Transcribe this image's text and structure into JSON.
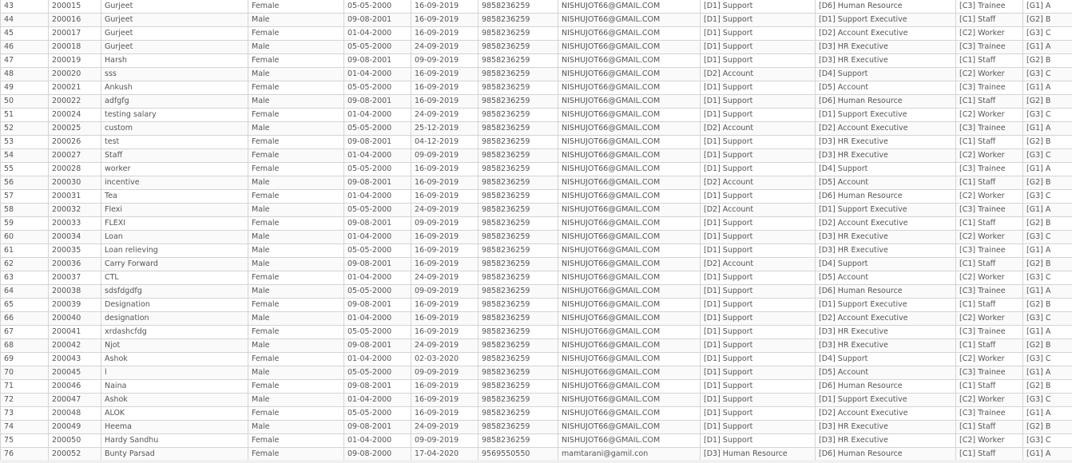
{
  "rows": [
    [
      "43",
      "200015",
      "Gurjeet",
      "Female",
      "05-05-2000",
      "16-09-2019",
      "9858236259",
      "NISHUJOT66@GMAIL.COM",
      "[D1] Support",
      "[D6] Human Resource",
      "[C3] Trainee",
      "[G1] A"
    ],
    [
      "44",
      "200016",
      "Gurjeet",
      "Male",
      "09-08-2001",
      "16-09-2019",
      "9858236259",
      "NISHUJOT66@GMAIL.COM",
      "[D1] Support",
      "[D1] Support Executive",
      "[C1] Staff",
      "[G2] B"
    ],
    [
      "45",
      "200017",
      "Gurjeet",
      "Female",
      "01-04-2000",
      "16-09-2019",
      "9858236259",
      "NISHUJOT66@GMAIL.COM",
      "[D1] Support",
      "[D2] Account Executive",
      "[C2] Worker",
      "[G3] C"
    ],
    [
      "46",
      "200018",
      "Gurjeet",
      "Male",
      "05-05-2000",
      "24-09-2019",
      "9858236259",
      "NISHUJOT66@GMAIL.COM",
      "[D1] Support",
      "[D3] HR Executive",
      "[C3] Trainee",
      "[G1] A"
    ],
    [
      "47",
      "200019",
      "Harsh",
      "Female",
      "09-08-2001",
      "09-09-2019",
      "9858236259",
      "NISHUJOT66@GMAIL.COM",
      "[D1] Support",
      "[D3] HR Executive",
      "[C1] Staff",
      "[G2] B"
    ],
    [
      "48",
      "200020",
      "sss",
      "Male",
      "01-04-2000",
      "16-09-2019",
      "9858236259",
      "NISHUJOT66@GMAIL.COM",
      "[D2] Account",
      "[D4] Support",
      "[C2] Worker",
      "[G3] C"
    ],
    [
      "49",
      "200021",
      "Ankush",
      "Female",
      "05-05-2000",
      "16-09-2019",
      "9858236259",
      "NISHUJOT66@GMAIL.COM",
      "[D1] Support",
      "[D5] Account",
      "[C3] Trainee",
      "[G1] A"
    ],
    [
      "50",
      "200022",
      "adfgfg",
      "Male",
      "09-08-2001",
      "16-09-2019",
      "9858236259",
      "NISHUJOT66@GMAIL.COM",
      "[D1] Support",
      "[D6] Human Resource",
      "[C1] Staff",
      "[G2] B"
    ],
    [
      "51",
      "200024",
      "testing salary",
      "Female",
      "01-04-2000",
      "24-09-2019",
      "9858236259",
      "NISHUJOT66@GMAIL.COM",
      "[D1] Support",
      "[D1] Support Executive",
      "[C2] Worker",
      "[G3] C"
    ],
    [
      "52",
      "200025",
      "custom",
      "Male",
      "05-05-2000",
      "25-12-2019",
      "9858236259",
      "NISHUJOT66@GMAIL.COM",
      "[D2] Account",
      "[D2] Account Executive",
      "[C3] Trainee",
      "[G1] A"
    ],
    [
      "53",
      "200026",
      "test",
      "Female",
      "09-08-2001",
      "04-12-2019",
      "9858236259",
      "NISHUJOT66@GMAIL.COM",
      "[D1] Support",
      "[D3] HR Executive",
      "[C1] Staff",
      "[G2] B"
    ],
    [
      "54",
      "200027",
      "Staff",
      "Female",
      "01-04-2000",
      "09-09-2019",
      "9858236259",
      "NISHUJOT66@GMAIL.COM",
      "[D1] Support",
      "[D3] HR Executive",
      "[C2] Worker",
      "[G3] C"
    ],
    [
      "55",
      "200028",
      "worker",
      "Female",
      "05-05-2000",
      "16-09-2019",
      "9858236259",
      "NISHUJOT66@GMAIL.COM",
      "[D1] Support",
      "[D4] Support",
      "[C3] Trainee",
      "[G1] A"
    ],
    [
      "56",
      "200030",
      "incentive",
      "Male",
      "09-08-2001",
      "16-09-2019",
      "9858236259",
      "NISHUJOT66@GMAIL.COM",
      "[D2] Account",
      "[D5] Account",
      "[C1] Staff",
      "[G2] B"
    ],
    [
      "57",
      "200031",
      "Tea",
      "Female",
      "01-04-2000",
      "16-09-2019",
      "9858236259",
      "NISHUJOT66@GMAIL.COM",
      "[D1] Support",
      "[D6] Human Resource",
      "[C2] Worker",
      "[G3] C"
    ],
    [
      "58",
      "200032",
      "Flexi",
      "Male",
      "05-05-2000",
      "24-09-2019",
      "9858236259",
      "NISHUJOT66@GMAIL.COM",
      "[D2] Account",
      "[D1] Support Executive",
      "[C3] Trainee",
      "[G1] A"
    ],
    [
      "59",
      "200033",
      "FLEXI",
      "Female",
      "09-08-2001",
      "09-09-2019",
      "9858236259",
      "NISHUJOT66@GMAIL.COM",
      "[D1] Support",
      "[D2] Account Executive",
      "[C1] Staff",
      "[G2] B"
    ],
    [
      "60",
      "200034",
      "Loan",
      "Male",
      "01-04-2000",
      "16-09-2019",
      "9858236259",
      "NISHUJOT66@GMAIL.COM",
      "[D1] Support",
      "[D3] HR Executive",
      "[C2] Worker",
      "[G3] C"
    ],
    [
      "61",
      "200035",
      "Loan relieving",
      "Male",
      "05-05-2000",
      "16-09-2019",
      "9858236259",
      "NISHUJOT66@GMAIL.COM",
      "[D1] Support",
      "[D3] HR Executive",
      "[C3] Trainee",
      "[G1] A"
    ],
    [
      "62",
      "200036",
      "Carry Forward",
      "Male",
      "09-08-2001",
      "16-09-2019",
      "9858236259",
      "NISHUJOT66@GMAIL.COM",
      "[D2] Account",
      "[D4] Support",
      "[C1] Staff",
      "[G2] B"
    ],
    [
      "63",
      "200037",
      "CTL",
      "Female",
      "01-04-2000",
      "24-09-2019",
      "9858236259",
      "NISHUJOT66@GMAIL.COM",
      "[D1] Support",
      "[D5] Account",
      "[C2] Worker",
      "[G3] C"
    ],
    [
      "64",
      "200038",
      "sdsfdgdfg",
      "Male",
      "05-05-2000",
      "09-09-2019",
      "9858236259",
      "NISHUJOT66@GMAIL.COM",
      "[D1] Support",
      "[D6] Human Resource",
      "[C3] Trainee",
      "[G1] A"
    ],
    [
      "65",
      "200039",
      "Designation",
      "Female",
      "09-08-2001",
      "16-09-2019",
      "9858236259",
      "NISHUJOT66@GMAIL.COM",
      "[D1] Support",
      "[D1] Support Executive",
      "[C1] Staff",
      "[G2] B"
    ],
    [
      "66",
      "200040",
      "designation",
      "Male",
      "01-04-2000",
      "16-09-2019",
      "9858236259",
      "NISHUJOT66@GMAIL.COM",
      "[D1] Support",
      "[D2] Account Executive",
      "[C2] Worker",
      "[G3] C"
    ],
    [
      "67",
      "200041",
      "xrdashcfdg",
      "Female",
      "05-05-2000",
      "16-09-2019",
      "9858236259",
      "NISHUJOT66@GMAIL.COM",
      "[D1] Support",
      "[D3] HR Executive",
      "[C3] Trainee",
      "[G1] A"
    ],
    [
      "68",
      "200042",
      "Njot",
      "Male",
      "09-08-2001",
      "24-09-2019",
      "9858236259",
      "NISHUJOT66@GMAIL.COM",
      "[D1] Support",
      "[D3] HR Executive",
      "[C1] Staff",
      "[G2] B"
    ],
    [
      "69",
      "200043",
      "Ashok",
      "Female",
      "01-04-2000",
      "02-03-2020",
      "9858236259",
      "NISHUJOT66@GMAIL.COM",
      "[D1] Support",
      "[D4] Support",
      "[C2] Worker",
      "[G3] C"
    ],
    [
      "70",
      "200045",
      "l",
      "Male",
      "05-05-2000",
      "09-09-2019",
      "9858236259",
      "NISHUJOT66@GMAIL.COM",
      "[D1] Support",
      "[D5] Account",
      "[C3] Trainee",
      "[G1] A"
    ],
    [
      "71",
      "200046",
      "Naina",
      "Female",
      "09-08-2001",
      "16-09-2019",
      "9858236259",
      "NISHUJOT66@GMAIL.COM",
      "[D1] Support",
      "[D6] Human Resource",
      "[C1] Staff",
      "[G2] B"
    ],
    [
      "72",
      "200047",
      "Ashok",
      "Male",
      "01-04-2000",
      "16-09-2019",
      "9858236259",
      "NISHUJOT66@GMAIL.COM",
      "[D1] Support",
      "[D1] Support Executive",
      "[C2] Worker",
      "[G3] C"
    ],
    [
      "73",
      "200048",
      "ALOK",
      "Female",
      "05-05-2000",
      "16-09-2019",
      "9858236259",
      "NISHUJOT66@GMAIL.COM",
      "[D1] Support",
      "[D2] Account Executive",
      "[C3] Trainee",
      "[G1] A"
    ],
    [
      "74",
      "200049",
      "Heema",
      "Male",
      "09-08-2001",
      "24-09-2019",
      "9858236259",
      "NISHUJOT66@GMAIL.COM",
      "[D1] Support",
      "[D3] HR Executive",
      "[C1] Staff",
      "[G2] B"
    ],
    [
      "75",
      "200050",
      "Hardy Sandhu",
      "Female",
      "01-04-2000",
      "09-09-2019",
      "9858236259",
      "NISHUJOT66@GMAIL.COM",
      "[D1] Support",
      "[D3] HR Executive",
      "[C2] Worker",
      "[G3] C"
    ],
    [
      "76",
      "200052",
      "Bunty Parsad",
      "Female",
      "09-08-2000",
      "17-04-2020",
      "9569550550",
      "mamtarani@gamil.con",
      "[D3] Human Resource",
      "[D6] Human Resource",
      "[C1] Staff",
      "[G1] A"
    ]
  ]
}
